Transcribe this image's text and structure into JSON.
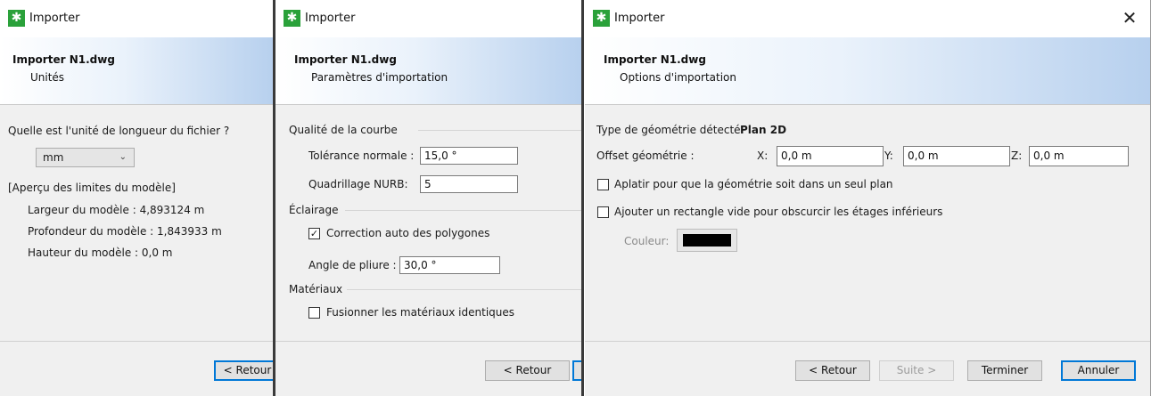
{
  "window1": {
    "title": "Importer",
    "file": "Importer N1.dwg",
    "step": "Unités",
    "question": "Quelle est l'unité de longueur du fichier ?",
    "unit_selected": "mm",
    "preview_header": "[Aperçu des limites du modèle]",
    "width_label": "Largeur du modèle : 4,893124 m",
    "depth_label": "Profondeur du modèle :  1,843933 m",
    "height_label": "Hauteur du modèle : 0,0 m",
    "back_button": "< Retour"
  },
  "window2": {
    "title": "Importer",
    "file": "Importer N1.dwg",
    "step": "Paramètres d'importation",
    "group_curve": "Qualité de la courbe",
    "tolerance_label": "Tolérance normale :",
    "tolerance_value": "15,0 °",
    "nurb_label": "Quadrillage NURB:",
    "nurb_value": "5",
    "group_light": "Éclairage",
    "auto_correct_label": "Correction auto des polygones",
    "auto_correct_checked": true,
    "fold_angle_label": "Angle de pliure :",
    "fold_angle_value": "30,0 °",
    "group_materials": "Matériaux",
    "merge_label": "Fusionner les matériaux identiques",
    "merge_checked": false,
    "back_button": "< Retour"
  },
  "window3": {
    "title": "Importer",
    "file": "Importer N1.dwg",
    "step": "Options d'importation",
    "geom_type_label": "Type de géométrie détecté:",
    "geom_type_value": "Plan 2D",
    "offset_label": "Offset géométrie :",
    "x_label": "X:",
    "x_value": "0,0 m",
    "y_label": "Y:",
    "y_value": "0,0 m",
    "z_label": "Z:",
    "z_value": "0,0 m",
    "flatten_label": "Aplatir pour que la géométrie soit dans un seul plan",
    "flatten_checked": false,
    "rect_label": "Ajouter un rectangle vide pour obscurcir les étages inférieurs",
    "rect_checked": false,
    "color_label": "Couleur:",
    "color_value": "#000000",
    "back_button": "< Retour",
    "next_button": "Suite >",
    "finish_button": "Terminer",
    "cancel_button": "Annuler"
  },
  "icons": {
    "app": "importer-runner-icon",
    "close": "close-icon",
    "dropdown": "chevron-down-icon",
    "check": "check-icon"
  },
  "colors": {
    "logo": "#2aa13a",
    "header_gradient_end": "#b7d0ee",
    "focus": "#0078d7"
  }
}
